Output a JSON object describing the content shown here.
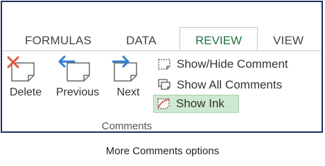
{
  "tabs": {
    "formulas": "FORMULAS",
    "data": "DATA",
    "review": "REVIEW",
    "view": "VIEW"
  },
  "buttons": {
    "delete": "Delete",
    "previous": "Previous",
    "next": "Next",
    "show_hide_comment": "Show/Hide Comment",
    "show_all_comments": "Show All Comments",
    "show_ink": "Show Ink"
  },
  "group_label": "Comments",
  "caption": "More Comments options",
  "colors": {
    "active_tab": "#217346",
    "delete_x": "#e0533b",
    "arrow": "#2f7fd0",
    "highlight": "#cfe8d0",
    "frame": "#1f2a60"
  },
  "icons": {
    "delete": "delete-comment-icon",
    "previous": "previous-comment-icon",
    "next": "next-comment-icon",
    "show_hide": "show-hide-comment-icon",
    "show_all": "show-all-comments-icon",
    "show_ink": "show-ink-icon"
  }
}
